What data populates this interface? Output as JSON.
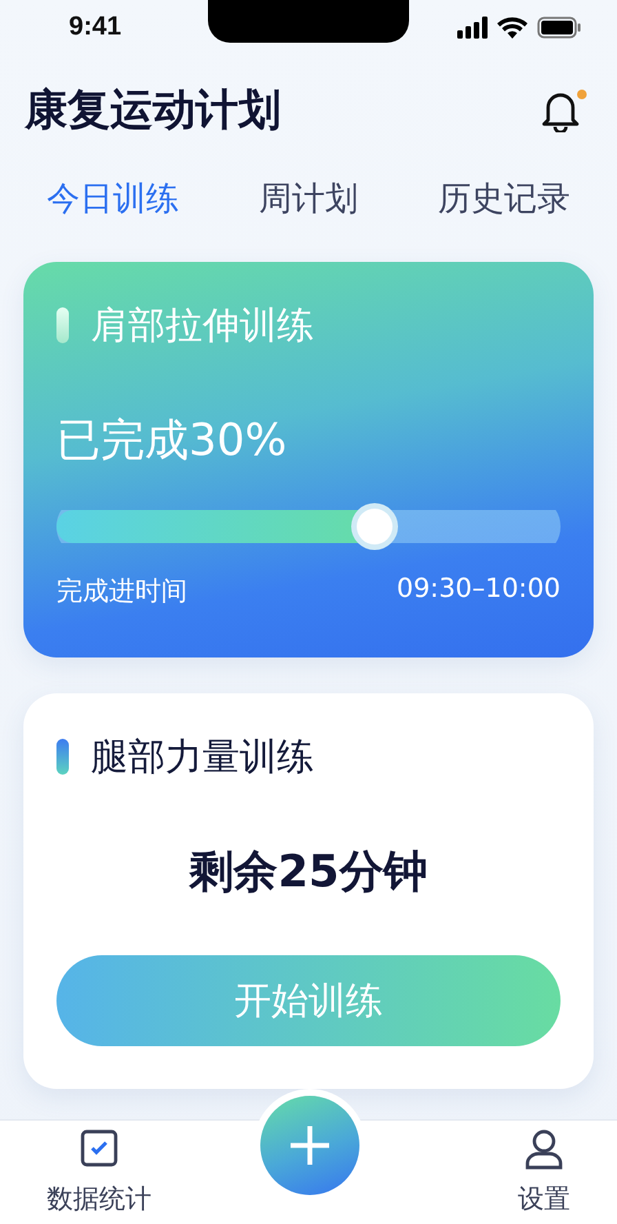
{
  "status_bar": {
    "time": "9:41"
  },
  "header": {
    "title": "康复运动计划",
    "notification": true
  },
  "tabs": [
    {
      "label": "今日训练",
      "selected": true
    },
    {
      "label": "周计划",
      "selected": false
    },
    {
      "label": "历史记录",
      "selected": false
    }
  ],
  "cards": [
    {
      "kind": "progress",
      "title": "肩部拉伸训练",
      "status": "已完成30%",
      "level": 0.63,
      "caption": "完成进时间",
      "time": "09:30–10:00"
    },
    {
      "kind": "action",
      "title": "腿部力量训练",
      "remaining": "剩余25分钟",
      "button": "开始训练"
    }
  ],
  "bottom_nav": [
    {
      "kind": "stats",
      "label": "数据统计"
    },
    {
      "kind": "add"
    },
    {
      "kind": "settings",
      "label": "设置"
    }
  ]
}
